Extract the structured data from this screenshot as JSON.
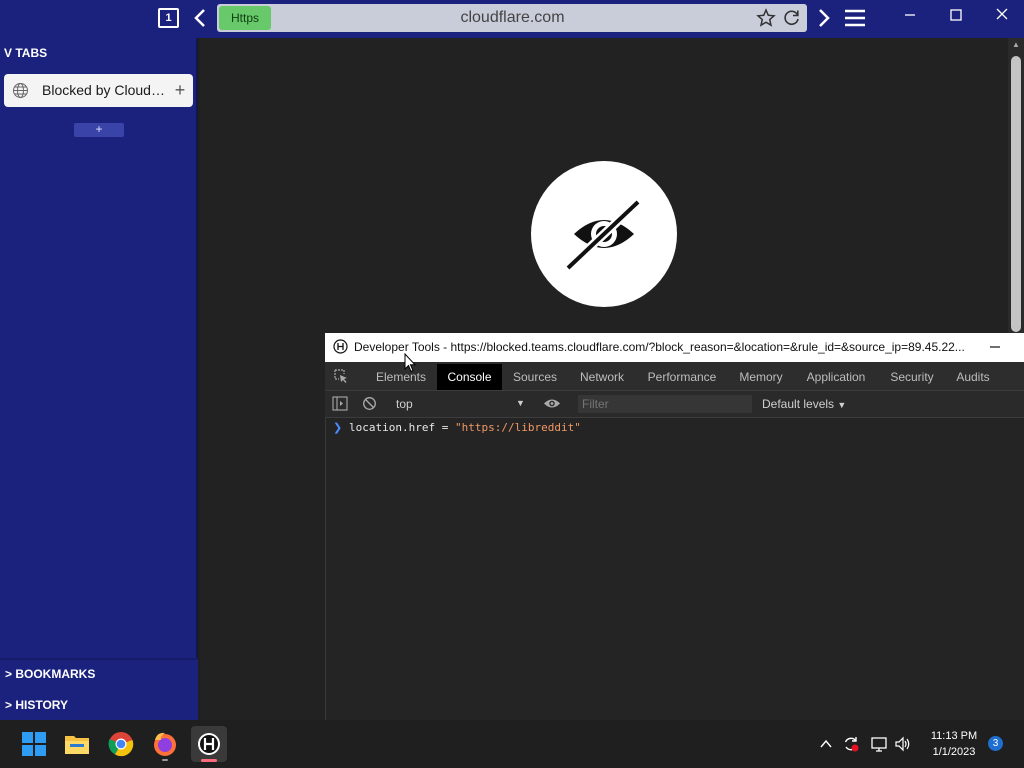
{
  "browser": {
    "tab_count": "1",
    "protocol_badge": "Https",
    "url": "cloudflare.com",
    "colors": {
      "chrome": "#1b227d",
      "https_badge": "#67c96a",
      "url_bar": "#c9ccd9"
    }
  },
  "sidebar": {
    "tabs_header": "V TABS",
    "tabs": [
      {
        "title": "Blocked by Cloudfl...",
        "icon": "globe-icon"
      }
    ],
    "tab_add": "+",
    "new_tab": "+",
    "bookmarks": "> BOOKMARKS",
    "history": "> HISTORY"
  },
  "page": {
    "icon": "eye-slash-icon"
  },
  "devtools": {
    "title": "Developer Tools - https://blocked.teams.cloudflare.com/?block_reason=&location=&rule_id=&source_ip=89.45.22...",
    "tabs": [
      "Elements",
      "Console",
      "Sources",
      "Network",
      "Performance",
      "Memory",
      "Application",
      "Security",
      "Audits"
    ],
    "active_tab": "Console",
    "context": "top",
    "filter_placeholder": "Filter",
    "levels": "Default levels",
    "console_input": {
      "object": "location",
      "property": ".href",
      "operator": " = ",
      "string": "\"https://libreddit\""
    }
  },
  "taskbar": {
    "apps": [
      "windows-start-icon",
      "file-explorer-icon",
      "chrome-icon",
      "firefox-icon",
      "hbrowser-icon"
    ],
    "time": "11:13 PM",
    "date": "1/1/2023",
    "notification_count": "3"
  }
}
